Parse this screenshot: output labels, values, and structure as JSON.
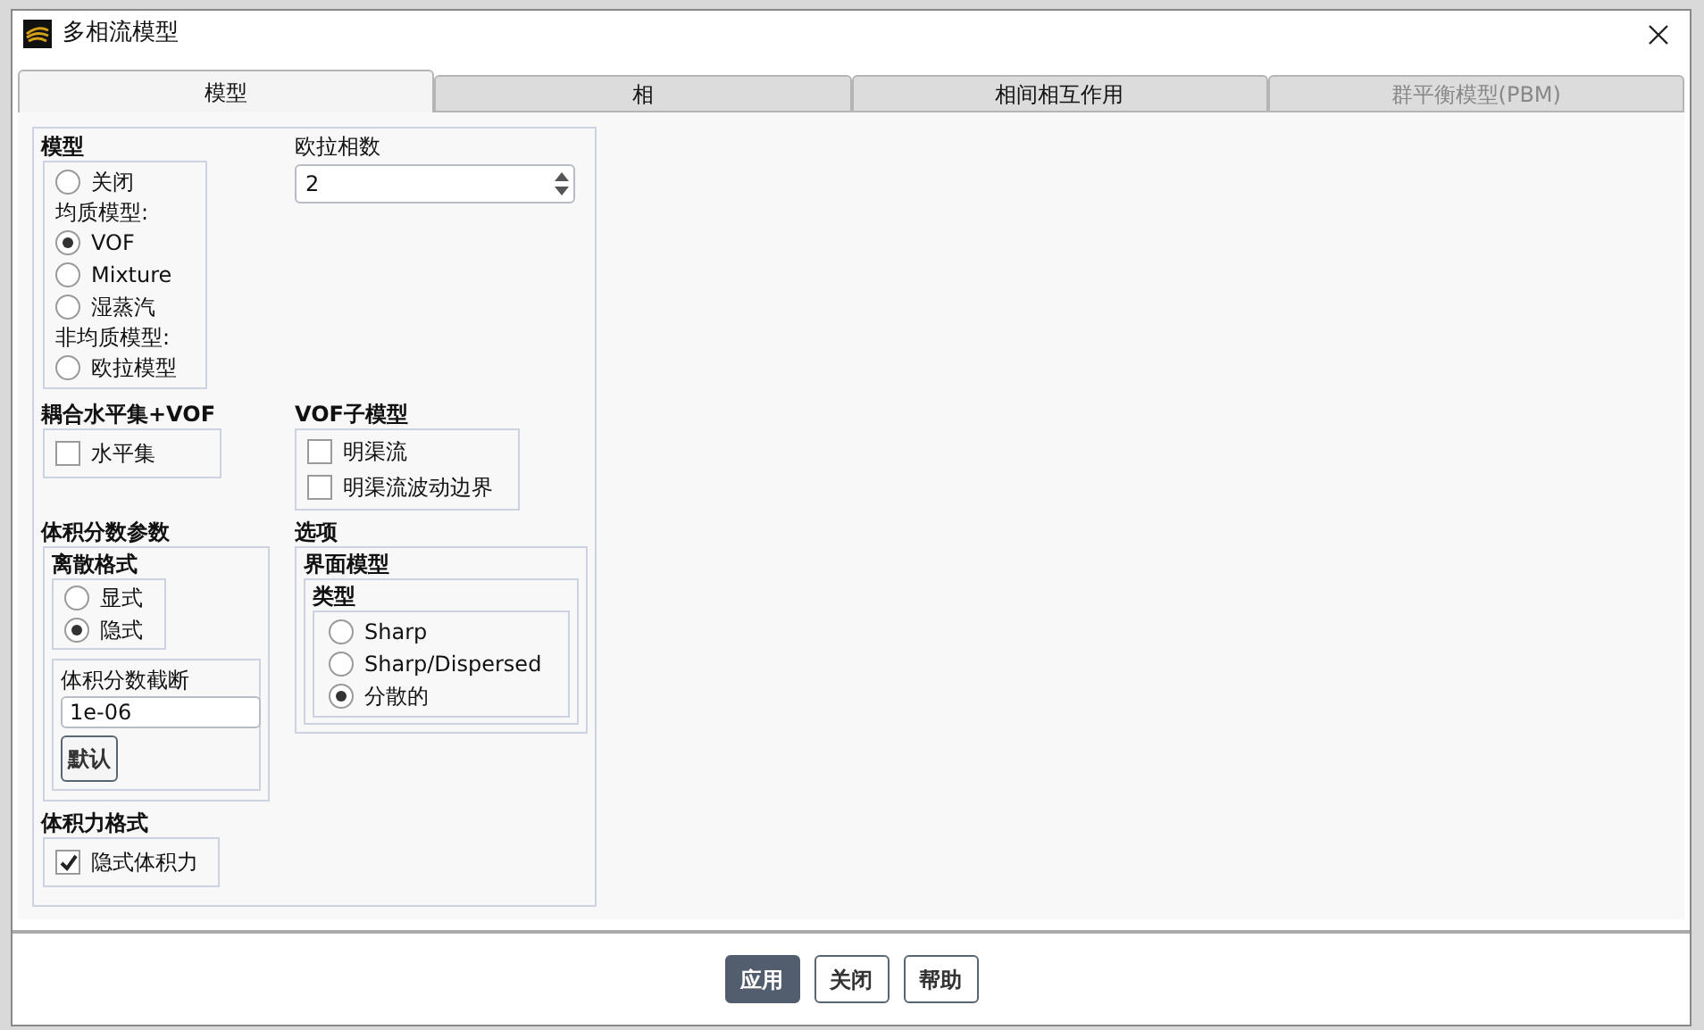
{
  "window": {
    "title": "多相流模型"
  },
  "tabs": [
    {
      "label": "模型",
      "selected": true,
      "disabled": false
    },
    {
      "label": "相",
      "selected": false,
      "disabled": false
    },
    {
      "label": "相间相互作用",
      "selected": false,
      "disabled": false
    },
    {
      "label": "群平衡模型(PBM)",
      "selected": false,
      "disabled": true
    }
  ],
  "model": {
    "title": "模型",
    "items": [
      {
        "kind": "radio",
        "label": "关闭",
        "selected": false
      },
      {
        "kind": "heading",
        "label": "均质模型:"
      },
      {
        "kind": "radio",
        "label": "VOF",
        "selected": true
      },
      {
        "kind": "radio",
        "label": "Mixture",
        "selected": false
      },
      {
        "kind": "radio",
        "label": "湿蒸汽",
        "selected": false
      },
      {
        "kind": "heading",
        "label": "非均质模型:"
      },
      {
        "kind": "radio",
        "label": "欧拉模型",
        "selected": false
      }
    ]
  },
  "euler_phases": {
    "label": "欧拉相数",
    "value": "2"
  },
  "coupled_level_set": {
    "title": "耦合水平集+VOF",
    "options": [
      {
        "label": "水平集",
        "checked": false
      }
    ]
  },
  "vof_submodels": {
    "title": "VOF子模型",
    "options": [
      {
        "label": "明渠流",
        "checked": false
      },
      {
        "label": "明渠流波动边界",
        "checked": false
      }
    ]
  },
  "volume_fraction": {
    "title": "体积分数参数",
    "scheme": {
      "title": "离散格式",
      "options": [
        {
          "label": "显式",
          "selected": false
        },
        {
          "label": "隐式",
          "selected": true
        }
      ]
    },
    "cutoff": {
      "label": "体积分数截断",
      "value": "1e-06",
      "button": "默认"
    }
  },
  "options": {
    "title": "选项",
    "interface": {
      "title": "界面模型",
      "type": {
        "title": "类型",
        "options": [
          {
            "label": "Sharp",
            "selected": false
          },
          {
            "label": "Sharp/Dispersed",
            "selected": false
          },
          {
            "label": "分散的",
            "selected": true
          }
        ]
      }
    }
  },
  "body_force": {
    "title": "体积力格式",
    "options": [
      {
        "label": "隐式体积力",
        "checked": true
      }
    ]
  },
  "buttons": [
    {
      "label": "应用",
      "primary": true
    },
    {
      "label": "关闭",
      "primary": false
    },
    {
      "label": "帮助",
      "primary": false
    }
  ]
}
